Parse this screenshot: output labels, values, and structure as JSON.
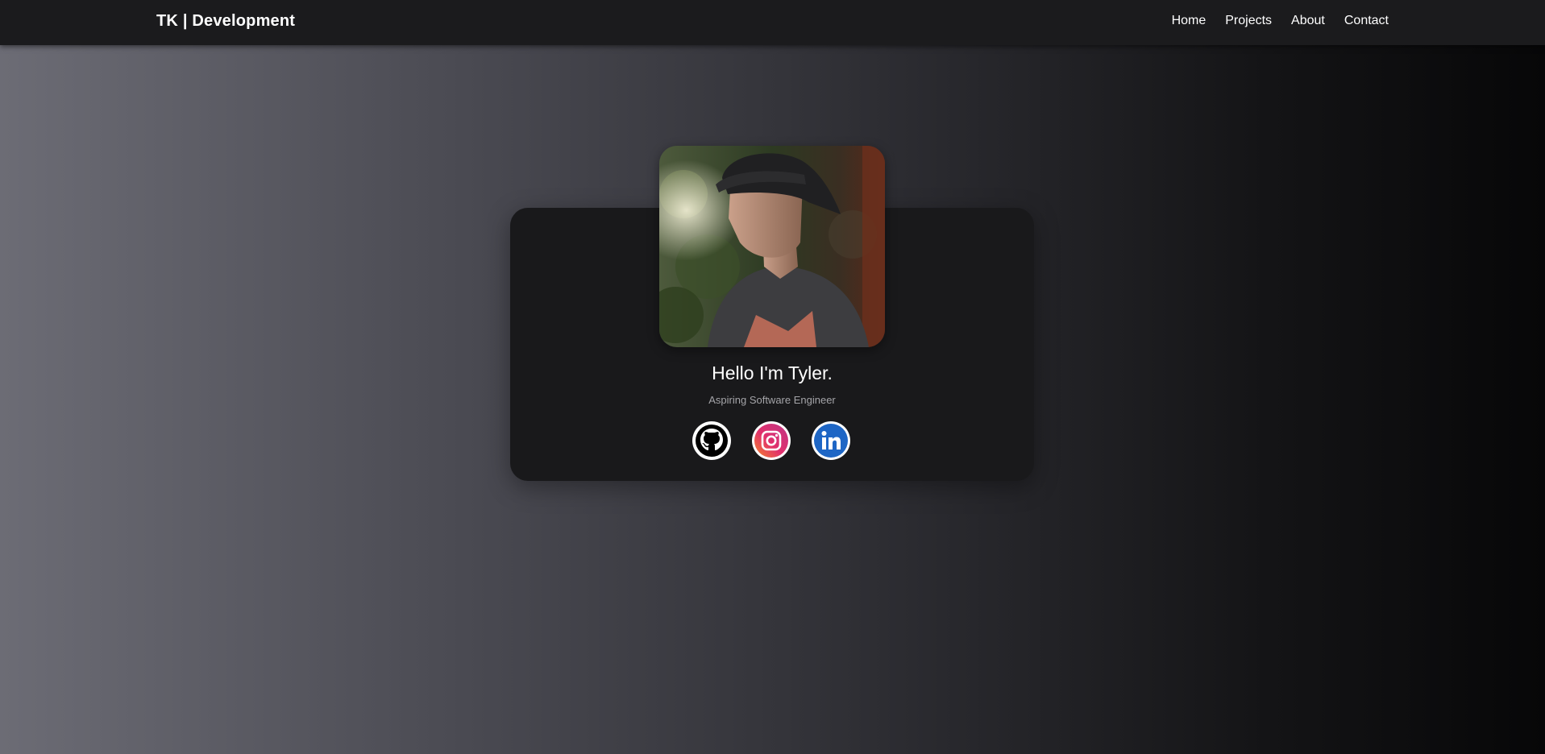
{
  "nav": {
    "brand": "TK | Development",
    "links": [
      "Home",
      "Projects",
      "About",
      "Contact"
    ]
  },
  "profile": {
    "greeting": "Hello I'm Tyler.",
    "subtitle": "Aspiring Software Engineer"
  },
  "social": [
    {
      "icon": "github-icon",
      "color": "#ffffff"
    },
    {
      "icon": "instagram-icon",
      "color": "#e1306c"
    },
    {
      "icon": "linkedin-icon",
      "color": "#1e66c5"
    }
  ],
  "colors": {
    "navbar": "#1b1b1d",
    "card": "#19191b",
    "text": "#ffffff",
    "subtext": "#a4a4a8"
  }
}
